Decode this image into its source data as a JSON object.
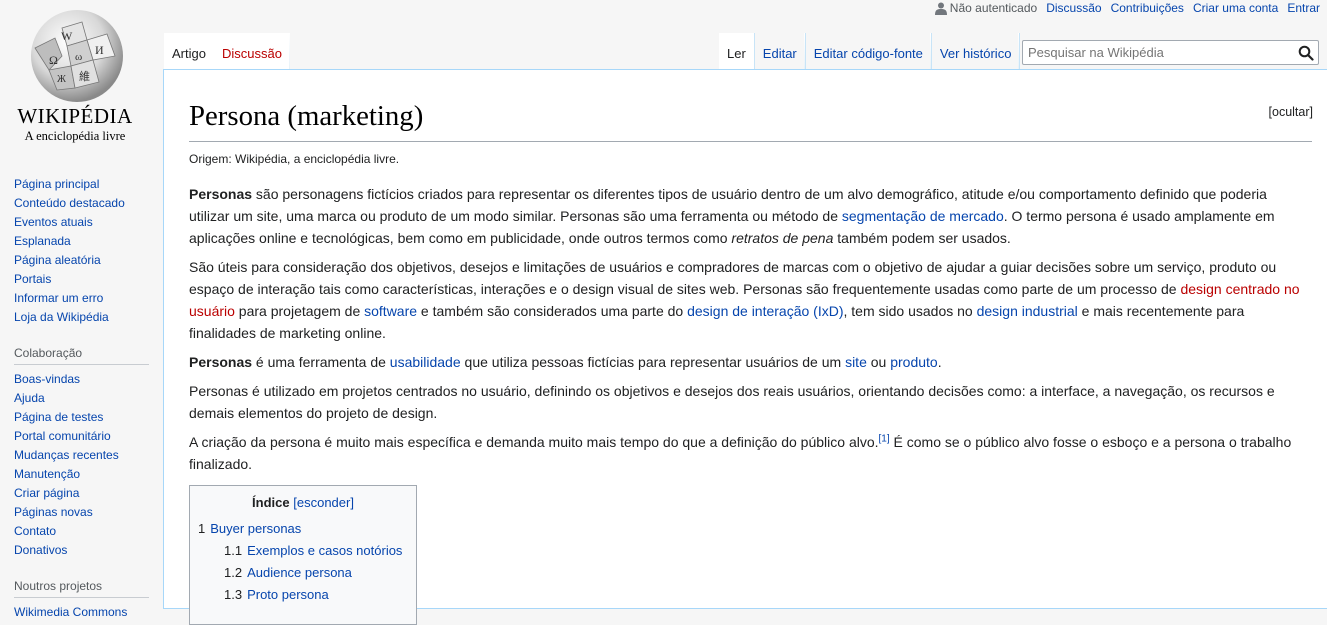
{
  "personal": {
    "user_status": "Não autenticado",
    "links": [
      "Discussão",
      "Contribuições",
      "Criar uma conta",
      "Entrar"
    ]
  },
  "logo": {
    "wordmark": "WIKIPÉDIA",
    "tagline": "A enciclopédia livre"
  },
  "sidebar": {
    "navigation": [
      "Página principal",
      "Conteúdo destacado",
      "Eventos atuais",
      "Esplanada",
      "Página aleatória",
      "Portais",
      "Informar um erro",
      "Loja da Wikipédia"
    ],
    "collab_heading": "Colaboração",
    "collab": [
      "Boas-vindas",
      "Ajuda",
      "Página de testes",
      "Portal comunitário",
      "Mudanças recentes",
      "Manutenção",
      "Criar página",
      "Páginas novas",
      "Contato",
      "Donativos"
    ],
    "projects_heading": "Noutros projetos",
    "projects": [
      "Wikimedia Commons"
    ]
  },
  "tabs": {
    "article": "Artigo",
    "discussion": "Discussão",
    "read": "Ler",
    "edit": "Editar",
    "edit_source": "Editar código-fonte",
    "history": "Ver histórico"
  },
  "search": {
    "placeholder": "Pesquisar na Wikipédia",
    "icon": "search-icon"
  },
  "article": {
    "title": "Persona (marketing)",
    "hide_link": "[ocultar]",
    "site_sub": "Origem: Wikipédia, a enciclopédia livre.",
    "p1": {
      "bold": "Personas",
      "t1": " são personagens fictícios criados para representar os diferentes tipos de usuário dentro de um alvo demográfico, atitude e/ou comportamento definido que poderia utilizar um site, uma marca ou produto de um modo similar. Personas são uma ferramenta ou método de ",
      "link1": "segmentação de mercado",
      "t2": ". O termo persona é usado amplamente em aplicações online e tecnológicas, bem como em publicidade, onde outros termos como ",
      "italic": "retratos de pena",
      "t3": " também podem ser usados."
    },
    "p2": {
      "t1": "São úteis para consideração dos objetivos, desejos e limitações de usuários e compradores de marcas com o objetivo de ajudar a guiar decisões sobre um serviço, produto ou espaço de interação tais como características, interações e o design visual de sites web. Personas são frequentemente usadas como parte de um processo de ",
      "link_red": "design centrado no usuário",
      "t2": " para projetagem de ",
      "link2": "software",
      "t3": " e também são considerados uma parte do ",
      "link3": "design de interação (IxD)",
      "t4": ", tem sido usados no ",
      "link4": "design industrial",
      "t5": " e mais recentemente para finalidades de marketing online."
    },
    "p3": {
      "bold": "Personas",
      "t1": " é uma ferramenta de ",
      "link1": "usabilidade",
      "t2": " que utiliza pessoas fictícias para representar usuários de um ",
      "link2": "site",
      "t3": " ou ",
      "link3": "produto",
      "t4": "."
    },
    "p4": "Personas é utilizado em projetos centrados no usuário, definindo os objetivos e desejos dos reais usuários, orientando decisões como: a interface, a navegação, os recursos e demais elementos do projeto de design.",
    "p5": {
      "t1": "A criação da persona é muito mais específica e demanda muito mais tempo do que a definição do público alvo.",
      "ref": "[1]",
      "t2": " É como se o público alvo fosse o esboço e a persona o trabalho finalizado."
    }
  },
  "toc": {
    "title": "Índice",
    "toggle": "[esconder]",
    "items": [
      {
        "num": "1",
        "label": "Buyer personas"
      },
      {
        "num": "1.1",
        "label": "Exemplos e casos notórios"
      },
      {
        "num": "1.2",
        "label": "Audience persona"
      },
      {
        "num": "1.3",
        "label": "Proto persona"
      }
    ]
  }
}
